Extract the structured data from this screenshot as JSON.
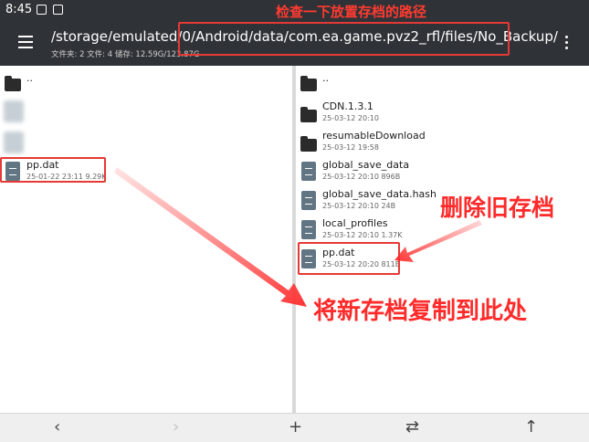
{
  "status": {
    "time": "8:45"
  },
  "toolbar": {
    "path": "/storage/emulated/0/Android/data/com.ea.game.pvz2_rfl/files/No_Backup/",
    "info": "文件夹: 2  文件: 4  储存: 12.59G/123.87G"
  },
  "left_pane": {
    "parent": "..",
    "file": {
      "name": "pp.dat",
      "meta": "25-01-22 23:11  9.29K"
    }
  },
  "right_pane": {
    "items": [
      {
        "name": "..",
        "meta": "",
        "type": "folder"
      },
      {
        "name": "CDN.1.3.1",
        "meta": "25-03-12 20:10",
        "type": "folder"
      },
      {
        "name": "resumableDownload",
        "meta": "25-03-12 19:58",
        "type": "folder"
      },
      {
        "name": "global_save_data",
        "meta": "25-03-12 20:10  896B",
        "type": "file"
      },
      {
        "name": "global_save_data.hash",
        "meta": "25-03-12 20:10  24B",
        "type": "file"
      },
      {
        "name": "local_profiles",
        "meta": "25-03-12 20:10  1.37K",
        "type": "file"
      },
      {
        "name": "pp.dat",
        "meta": "25-03-12 20:20  811B",
        "type": "file"
      }
    ]
  },
  "bottombar": {
    "back": "‹",
    "forward": "›",
    "add": "+",
    "swap": "⇄",
    "up": "↑"
  },
  "annotations": {
    "check_path": "检查一下放置存档的路径",
    "delete_old": "删除旧存档",
    "copy_here": "将新存档复制到此处"
  },
  "colors": {
    "toolbar": "#2f3237",
    "annotation": "#e53935",
    "file_icon": "#617583"
  }
}
